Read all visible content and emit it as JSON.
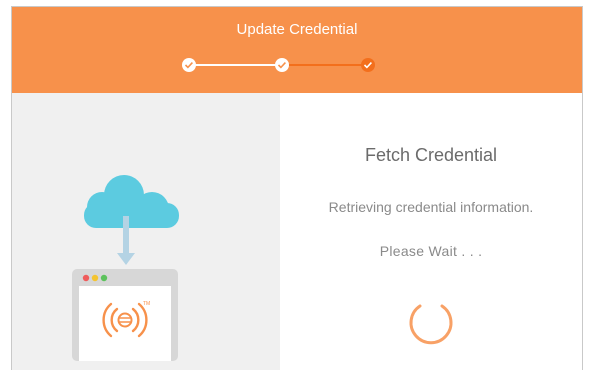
{
  "dialog": {
    "title": "Update Credential",
    "steps": [
      {
        "state": "done"
      },
      {
        "state": "done"
      },
      {
        "state": "active"
      }
    ]
  },
  "content": {
    "heading": "Fetch Credential",
    "message": "Retrieving credential information.",
    "wait": "Please Wait . . ."
  },
  "colors": {
    "accent": "#f7914b",
    "step_active": "#f36f1c",
    "cloud": "#5ccbe0",
    "arrow": "#b4d3e4",
    "spinner": "#f7914b"
  },
  "icons": {
    "step_done": "check-icon",
    "cloud": "cloud-icon",
    "download_arrow": "down-arrow-icon",
    "app_logo": "broadcast-logo-icon",
    "spinner": "loading-spinner-icon"
  }
}
